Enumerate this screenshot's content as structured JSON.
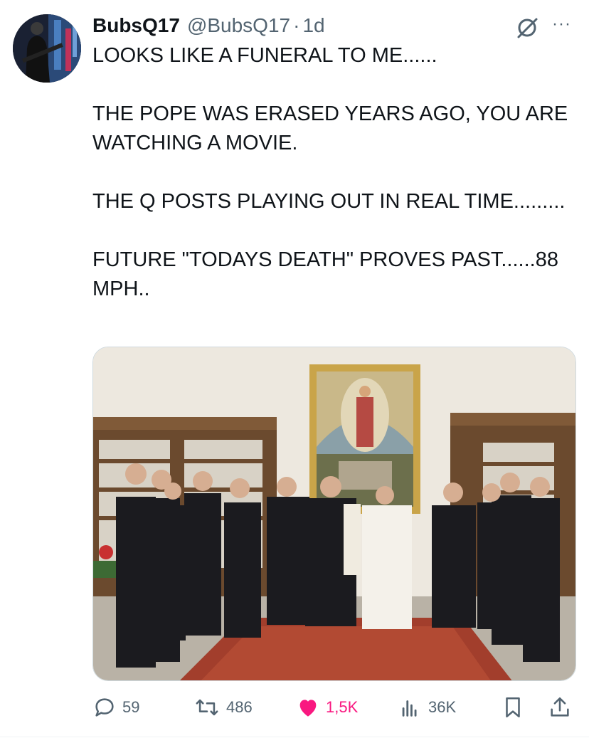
{
  "tweet": {
    "display_name": "BubsQ17",
    "handle": "@BubsQ17",
    "separator": "·",
    "time": "1d",
    "more_label": "···",
    "text": "LOOKS LIKE A FUNERAL TO ME......\n\nTHE POPE WAS ERASED YEARS AGO, YOU ARE WATCHING A MOVIE.\n\nTHE Q POSTS PLAYING OUT IN REAL TIME.........\n\nFUTURE \"TODAYS DEATH\" PROVES PAST......88 MPH.."
  },
  "actions": {
    "replies": "59",
    "reposts": "486",
    "likes": "1,5K",
    "views": "36K"
  },
  "colors": {
    "secondary": "#536471",
    "like": "#f91880"
  },
  "icons": [
    "grok-icon",
    "more-icon",
    "reply-icon",
    "repost-icon",
    "heart-icon",
    "views-icon",
    "bookmark-icon",
    "share-icon"
  ]
}
